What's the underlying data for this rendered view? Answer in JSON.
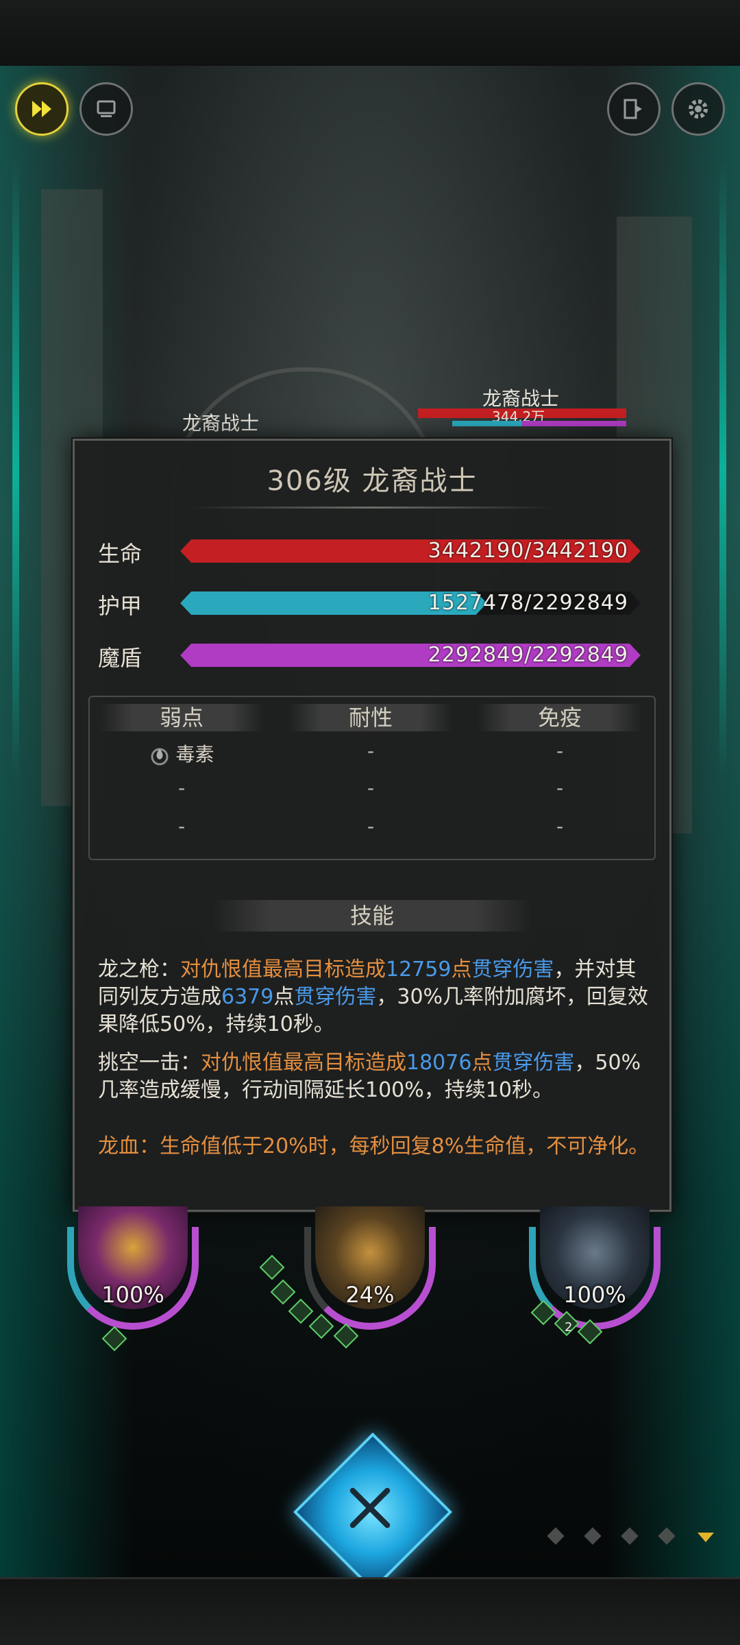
{
  "top_left_buttons": [
    {
      "icon": "fast-forward-icon"
    },
    {
      "icon": "auto-battle-icon"
    }
  ],
  "top_right_buttons": [
    {
      "icon": "exit-icon"
    },
    {
      "icon": "gear-icon"
    }
  ],
  "enemies": [
    {
      "name": "龙裔战士"
    },
    {
      "name": "龙裔战士",
      "hp_text": "344.2万"
    }
  ],
  "panel": {
    "title": "306级  龙裔战士",
    "stats": [
      {
        "label": "生命",
        "value": "3442190/3442190",
        "fill": 1.0,
        "color": "#c41f22"
      },
      {
        "label": "护甲",
        "value": "1527478/2292849",
        "fill": 0.666,
        "color": "#2aa9bd"
      },
      {
        "label": "魔盾",
        "value": "2292849/2292849",
        "fill": 1.0,
        "color": "#b03cc4"
      }
    ],
    "resistance": {
      "headers": [
        "弱点",
        "耐性",
        "免疫"
      ],
      "weakness": [
        "毒素",
        "-",
        "-"
      ],
      "resist": [
        "-",
        "-",
        "-"
      ],
      "immune": [
        "-",
        "-",
        "-"
      ]
    },
    "skills_header": "技能",
    "skills": {
      "s1": {
        "name": "龙之枪：",
        "t1": "对仇恨值最高目标造成",
        "n1": "12759",
        "t2": "点",
        "k1": "贯穿伤害",
        "t3": "，并对其同列友方造成",
        "n2": "6379",
        "t4": "点",
        "k2": "贯穿伤害",
        "t5": "，30%几率附加腐坏，回复效果降低50%，持续10秒。"
      },
      "s2": {
        "name": "挑空一击：",
        "t1": "对仇恨值最高目标造成",
        "n1": "18076",
        "t2": "点",
        "k1": "贯穿伤害",
        "t3": "，50%几率造成缓慢，行动间隔延长100%，持续10秒。"
      },
      "s3": {
        "text": "龙血：生命值低于20%时，每秒回复8%生命值，不可净化。"
      }
    }
  },
  "heroes": [
    {
      "percent": "100%"
    },
    {
      "percent": "24%"
    },
    {
      "percent": "100%",
      "buff_stack": "2"
    }
  ],
  "cancel_icon": "close-icon"
}
